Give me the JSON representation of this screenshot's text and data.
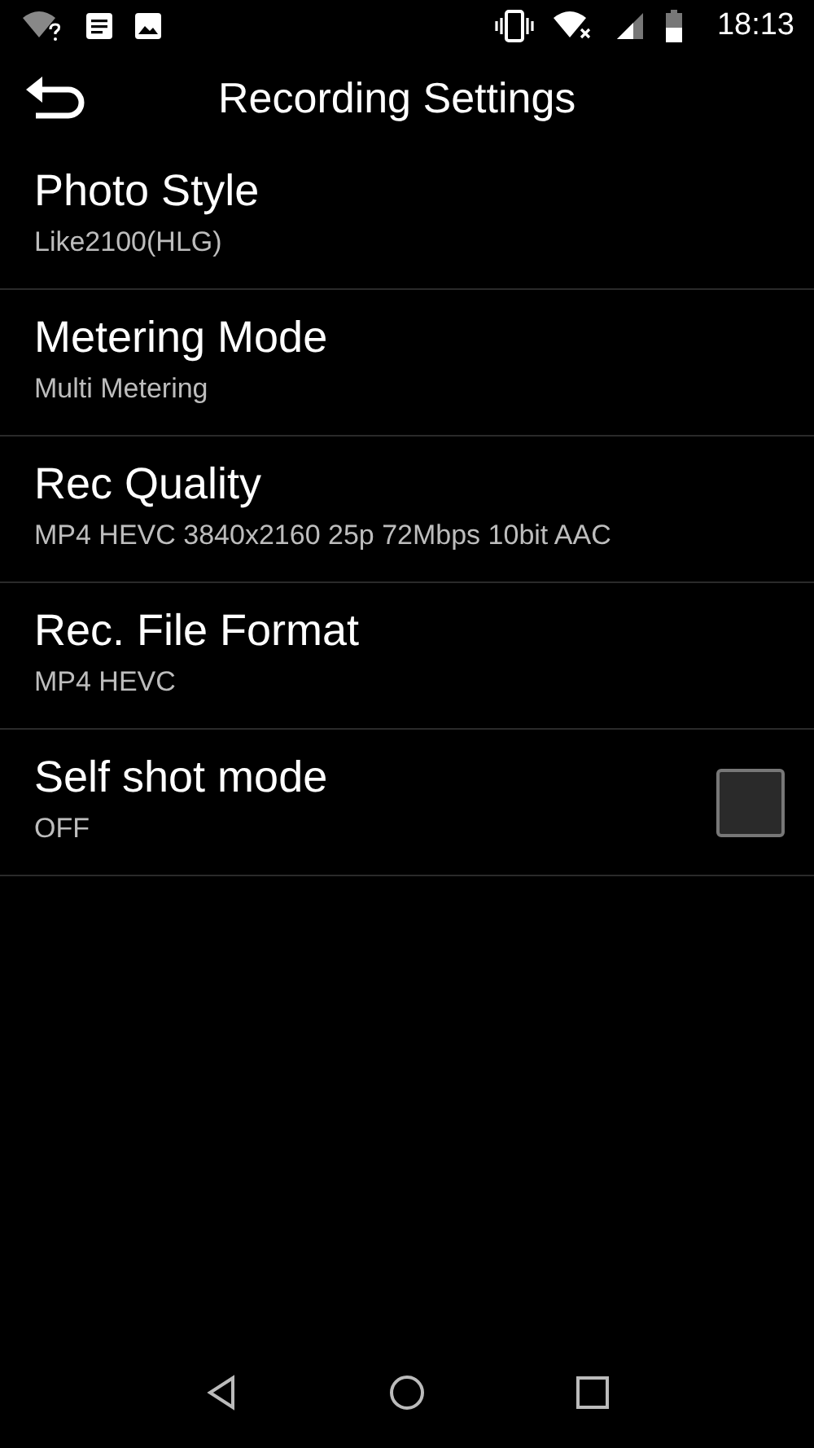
{
  "status_bar": {
    "time": "18:13"
  },
  "header": {
    "title": "Recording Settings"
  },
  "settings": [
    {
      "kind": "value",
      "title": "Photo Style",
      "value": "Like2100(HLG)"
    },
    {
      "kind": "value",
      "title": "Metering Mode",
      "value": "Multi Metering"
    },
    {
      "kind": "value",
      "title": "Rec Quality",
      "value": "MP4 HEVC 3840x2160 25p 72Mbps 10bit AAC"
    },
    {
      "kind": "value",
      "title": "Rec. File Format",
      "value": "MP4 HEVC"
    },
    {
      "kind": "checkbox",
      "title": "Self shot mode",
      "value": "OFF",
      "checked": false
    }
  ]
}
